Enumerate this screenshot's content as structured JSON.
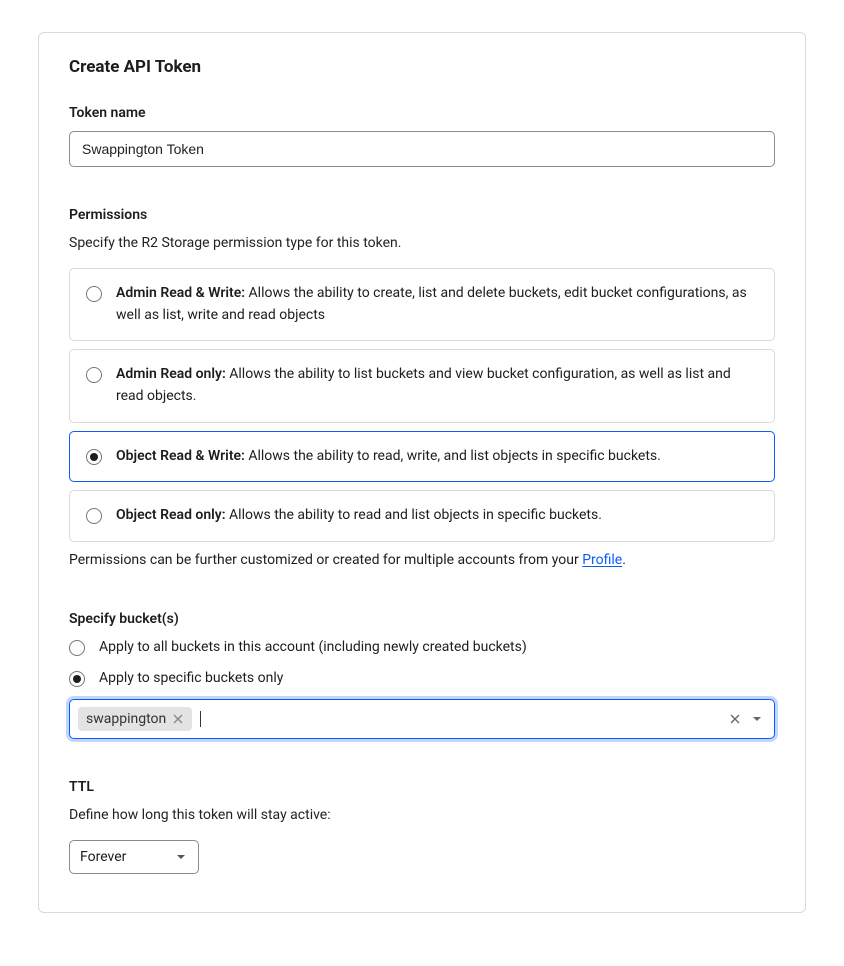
{
  "header": {
    "title": "Create API Token"
  },
  "tokenName": {
    "label": "Token name",
    "value": "Swappington Token"
  },
  "permissions": {
    "label": "Permissions",
    "description": "Specify the R2 Storage permission type for this token.",
    "options": [
      {
        "title": "Admin Read & Write:",
        "desc": " Allows the ability to create, list and delete buckets, edit bucket configurations, as well as list, write and read objects"
      },
      {
        "title": "Admin Read only:",
        "desc": " Allows the ability to list buckets and view bucket configuration, as well as list and read objects."
      },
      {
        "title": "Object Read & Write:",
        "desc": " Allows the ability to read, write, and list objects in specific buckets."
      },
      {
        "title": "Object Read only:",
        "desc": " Allows the ability to read and list objects in specific buckets."
      }
    ],
    "selectedIndex": 2,
    "footnote_pre": "Permissions can be further customized or created for multiple accounts from your ",
    "footnote_link": "Profile",
    "footnote_post": "."
  },
  "buckets": {
    "label": "Specify bucket(s)",
    "optAll": "Apply to all buckets in this account (including newly created buckets)",
    "optSpecific": "Apply to specific buckets only",
    "selected": "specific",
    "chips": [
      "swappington"
    ]
  },
  "ttl": {
    "label": "TTL",
    "description": "Define how long this token will stay active:",
    "value": "Forever"
  }
}
